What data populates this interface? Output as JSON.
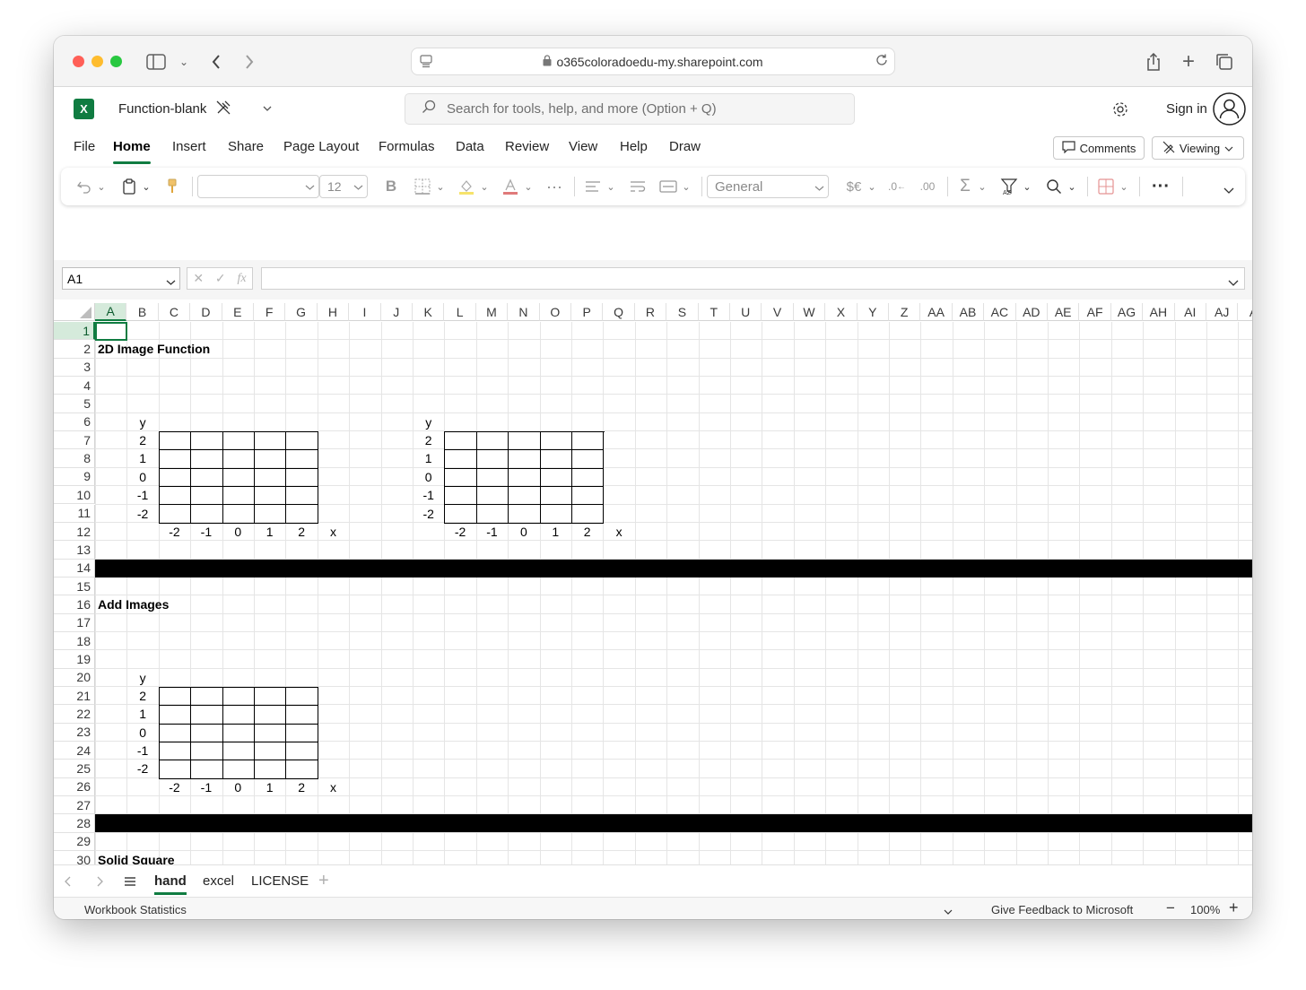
{
  "browser": {
    "url": "o365coloradoedu-my.sharepoint.com"
  },
  "app": {
    "file_name": "Function-blank",
    "search_placeholder": "Search for tools, help, and more (Option + Q)",
    "sign_in": "Sign in",
    "comments": "Comments",
    "viewing": "Viewing",
    "accent": "#107c41"
  },
  "ribbon_tabs": [
    "File",
    "Home",
    "Insert",
    "Share",
    "Page Layout",
    "Formulas",
    "Data",
    "Review",
    "View",
    "Help",
    "Draw"
  ],
  "toolbar": {
    "font_size": "12",
    "number_format": "General"
  },
  "formula_bar": {
    "name_box": "A1",
    "fx": "fx"
  },
  "columns": [
    "A",
    "B",
    "C",
    "D",
    "E",
    "F",
    "G",
    "H",
    "I",
    "J",
    "K",
    "L",
    "M",
    "N",
    "O",
    "P",
    "Q",
    "R",
    "S",
    "T",
    "U",
    "V",
    "W",
    "X",
    "Y",
    "Z",
    "AA",
    "AB",
    "AC",
    "AD",
    "AE",
    "AF",
    "AG",
    "AH",
    "AI",
    "AJ",
    "A"
  ],
  "rows": [
    "1",
    "2",
    "3",
    "4",
    "5",
    "6",
    "7",
    "8",
    "9",
    "10",
    "11",
    "12",
    "13",
    "14",
    "15",
    "16",
    "17",
    "18",
    "19",
    "20",
    "21",
    "22",
    "23",
    "24",
    "25",
    "26",
    "27",
    "28",
    "29",
    "30"
  ],
  "sheet": {
    "title_2d": "2D Image Function",
    "title_add": "Add Images",
    "title_solid": "Solid Square",
    "y_label": "y",
    "x_label": "x",
    "y_ticks": [
      "2",
      "1",
      "0",
      "-1",
      "-2"
    ],
    "x_ticks": [
      "-2",
      "-1",
      "0",
      "1",
      "2"
    ]
  },
  "sheet_tabs": [
    "hand",
    "excel",
    "LICENSE"
  ],
  "status": {
    "left": "Workbook Statistics",
    "feedback": "Give Feedback to Microsoft",
    "zoom": "100%"
  }
}
